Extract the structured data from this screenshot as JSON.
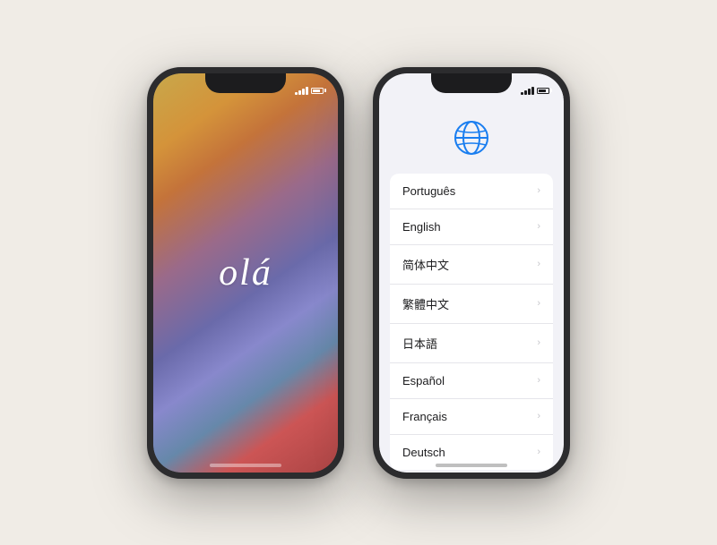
{
  "left_phone": {
    "status": {
      "time": "",
      "signal": "full",
      "wifi": true,
      "battery": "70"
    },
    "screen": {
      "text": "olá"
    }
  },
  "right_phone": {
    "status": {
      "time": "",
      "signal": "full",
      "wifi": true,
      "battery": "70"
    },
    "globe_icon": "🌐",
    "languages": [
      {
        "label": "Português",
        "chevron": "›"
      },
      {
        "label": "English",
        "chevron": "›"
      },
      {
        "label": "简体中文",
        "chevron": "›"
      },
      {
        "label": "繁體中文",
        "chevron": "›"
      },
      {
        "label": "日本語",
        "chevron": "›"
      },
      {
        "label": "Español",
        "chevron": "›"
      },
      {
        "label": "Français",
        "chevron": "›"
      },
      {
        "label": "Deutsch",
        "chevron": "›"
      }
    ]
  }
}
